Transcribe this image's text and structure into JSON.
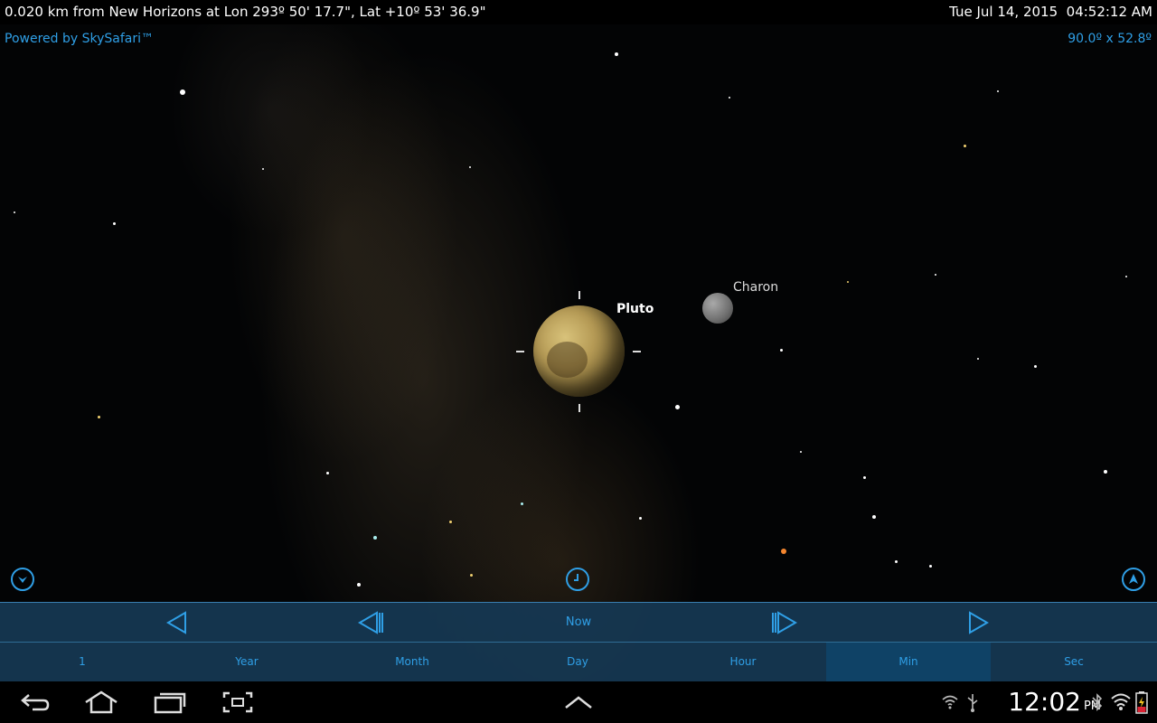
{
  "status": {
    "location": "0.020 km from New Horizons at Lon 293º 50' 17.7\", Lat +10º 53' 36.9\"",
    "datetime": "Tue Jul 14, 2015  04:52:12 AM"
  },
  "branding": {
    "powered_by": "Powered by SkySafari™"
  },
  "view": {
    "fov": "90.0º x 52.8º"
  },
  "objects": {
    "pluto_label": "Pluto",
    "charon_label": "Charon"
  },
  "time_controls": {
    "step_back": "◁",
    "step_back_frame": "◁|",
    "now_label": "Now",
    "step_fwd_frame": "|▷",
    "step_fwd": "▷"
  },
  "units": {
    "items": [
      "1",
      "Year",
      "Month",
      "Day",
      "Hour",
      "Min",
      "Sec"
    ],
    "selected": "Min"
  },
  "system": {
    "time": "12:02",
    "ampm": "PM"
  },
  "colors": {
    "accent": "#2f9fe6",
    "panel": "#163854",
    "selected_segment": "#0f4266"
  }
}
